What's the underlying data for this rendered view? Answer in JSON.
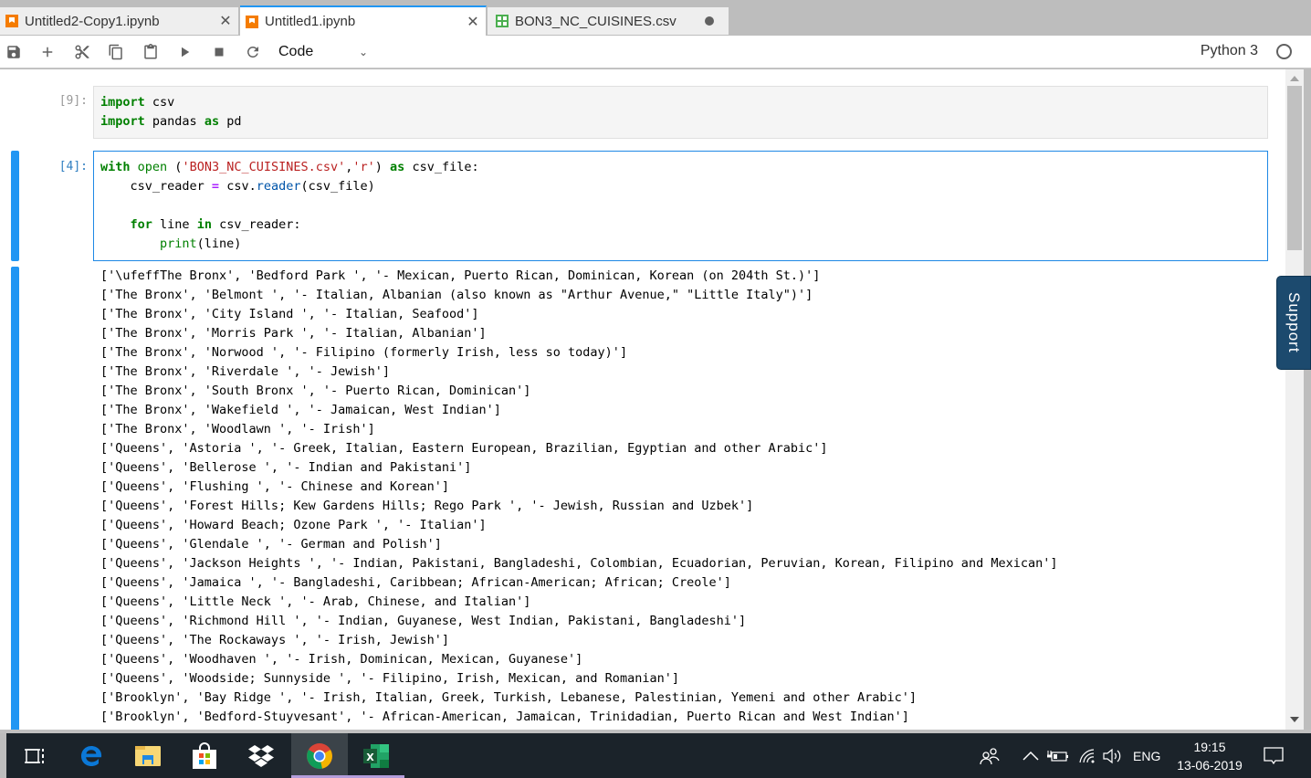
{
  "tabs": [
    {
      "label": "Untitled2-Copy1.ipynb",
      "icon": "notebook-icon",
      "active": false,
      "close": "✕"
    },
    {
      "label": "Untitled1.ipynb",
      "icon": "notebook-icon",
      "active": true,
      "close": "✕"
    },
    {
      "label": "BON3_NC_CUISINES.csv",
      "icon": "csv-grid-icon",
      "active": false,
      "unsaved": true
    }
  ],
  "toolbar": {
    "buttons": [
      "save-icon",
      "add-cell-icon",
      "cut-icon",
      "copy-icon",
      "paste-icon",
      "run-icon",
      "stop-icon",
      "restart-icon"
    ],
    "cell_type": "Code",
    "kernel_name": "Python 3",
    "kernel_status": "idle"
  },
  "cells": [
    {
      "prompt": "[9]:",
      "code": [
        "import csv",
        "import pandas as pd"
      ]
    },
    {
      "prompt": "[4]:",
      "code": [
        "with open ('BON3_NC_CUISINES.csv','r') as csv_file:",
        "    csv_reader = csv.reader(csv_file)",
        "",
        "    for line in csv_reader:",
        "        print(line)"
      ],
      "output": [
        "['\\ufeffThe Bronx', 'Bedford Park ', '- Mexican, Puerto Rican, Dominican, Korean (on 204th St.)']",
        "['The Bronx', 'Belmont ', '- Italian, Albanian (also known as \"Arthur Avenue,\" \"Little Italy\")']",
        "['The Bronx', 'City Island ', '- Italian, Seafood']",
        "['The Bronx', 'Morris Park ', '- Italian, Albanian']",
        "['The Bronx', 'Norwood ', '- Filipino (formerly Irish, less so today)']",
        "['The Bronx', 'Riverdale ', '- Jewish']",
        "['The Bronx', 'South Bronx ', '- Puerto Rican, Dominican']",
        "['The Bronx', 'Wakefield ', '- Jamaican, West Indian']",
        "['The Bronx', 'Woodlawn ', '- Irish']",
        "['Queens', 'Astoria ', '- Greek, Italian, Eastern European, Brazilian, Egyptian and other Arabic']",
        "['Queens', 'Bellerose ', '- Indian and Pakistani']",
        "['Queens', 'Flushing ', '- Chinese and Korean']",
        "['Queens', 'Forest Hills; Kew Gardens Hills; Rego Park ', '- Jewish, Russian and Uzbek']",
        "['Queens', 'Howard Beach; Ozone Park ', '- Italian']",
        "['Queens', 'Glendale ', '- German and Polish']",
        "['Queens', 'Jackson Heights ', '- Indian, Pakistani, Bangladeshi, Colombian, Ecuadorian, Peruvian, Korean, Filipino and Mexican']",
        "['Queens', 'Jamaica ', '- Bangladeshi, Caribbean; African-American; African; Creole']",
        "['Queens', 'Little Neck ', '- Arab, Chinese, and Italian']",
        "['Queens', 'Richmond Hill ', '- Indian, Guyanese, West Indian, Pakistani, Bangladeshi']",
        "['Queens', 'The Rockaways ', '- Irish, Jewish']",
        "['Queens', 'Woodhaven ', '- Irish, Dominican, Mexican, Guyanese']",
        "['Queens', 'Woodside; Sunnyside ', '- Filipino, Irish, Mexican, and Romanian']",
        "['Brooklyn', 'Bay Ridge ', '- Irish, Italian, Greek, Turkish, Lebanese, Palestinian, Yemeni and other Arabic']",
        "['Brooklyn', 'Bedford-Stuyvesant', '- African-American, Jamaican, Trinidadian, Puerto Rican and West Indian']"
      ]
    }
  ],
  "support_label": "Support",
  "taskbar": {
    "apps": [
      "task-view-icon",
      "edge-icon",
      "file-explorer-icon",
      "store-icon",
      "dropbox-icon",
      "chrome-icon",
      "excel-icon"
    ],
    "active_app": "chrome-icon",
    "language": "ENG",
    "time": "19:15",
    "date": "13-06-2019"
  },
  "colors": {
    "accent": "#2196f3",
    "keyword": "#008000",
    "string": "#ba2121",
    "support_bg": "#1c4a6e",
    "taskbar_bg": "#1b232a"
  }
}
